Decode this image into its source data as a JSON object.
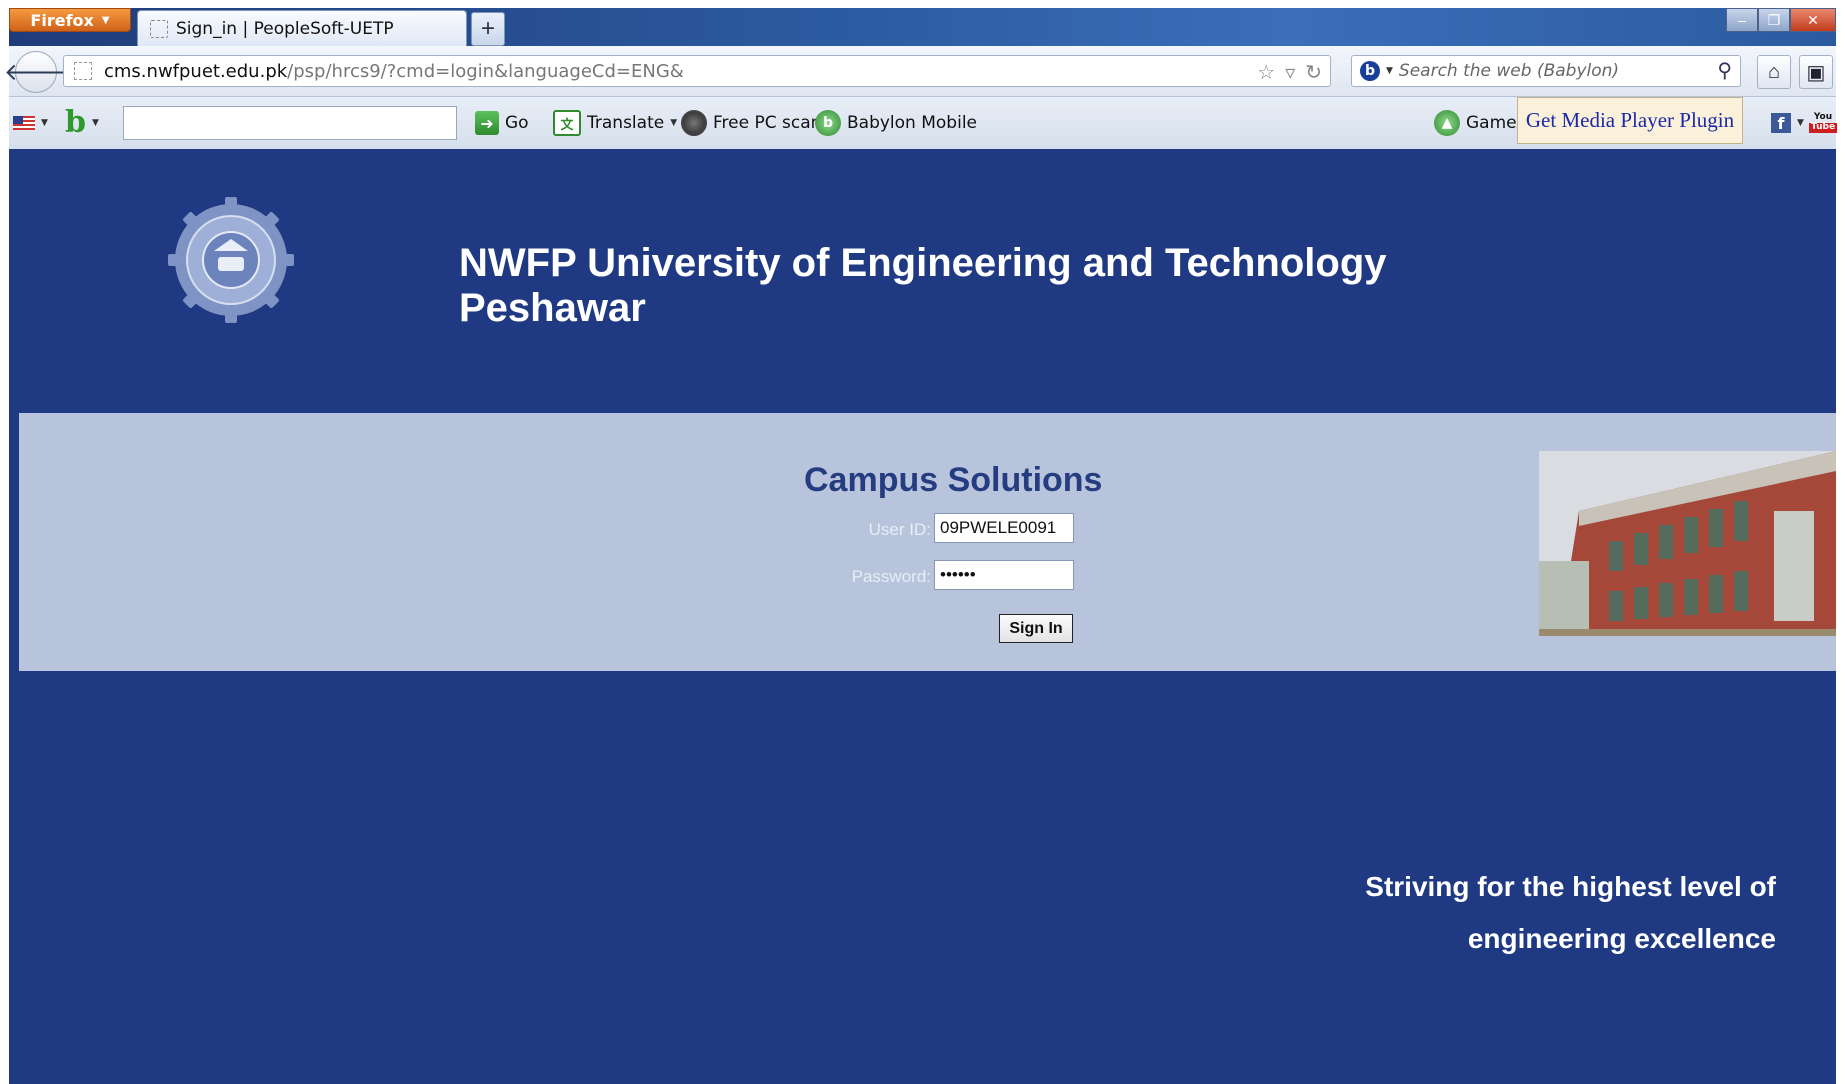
{
  "browser": {
    "app_button": "Firefox",
    "tab_title": "Sign_in | PeopleSoft-UETP",
    "new_tab": "+",
    "url_domain": "cms.nwfpuet.edu.pk",
    "url_path": "/psp/hrcs9/?cmd=login&languageCd=ENG&",
    "search_placeholder": "Search the web (Babylon)"
  },
  "toolbar": {
    "go_label": "Go",
    "translate_label": "Translate",
    "freescan_label": "Free PC scan",
    "babylon_mobile_label": "Babylon Mobile",
    "games_label": "Games",
    "plugin_label": "Get Media Player Plugin",
    "yt_top": "You",
    "yt_bottom": "Tube"
  },
  "page": {
    "title": "NWFP University of Engineering and Technology Peshawar",
    "panel_title": "Campus Solutions",
    "userid_label": "User ID:",
    "userid_value": "09PWELE0091",
    "password_label": "Password:",
    "password_value": "••••••",
    "signin_label": "Sign In",
    "tagline_line1": "Striving for the highest level of",
    "tagline_line2": "engineering excellence"
  },
  "colors": {
    "page_bg": "#1f3a83",
    "panel_bg": "#b8c4dc",
    "panel_title": "#253c80"
  }
}
